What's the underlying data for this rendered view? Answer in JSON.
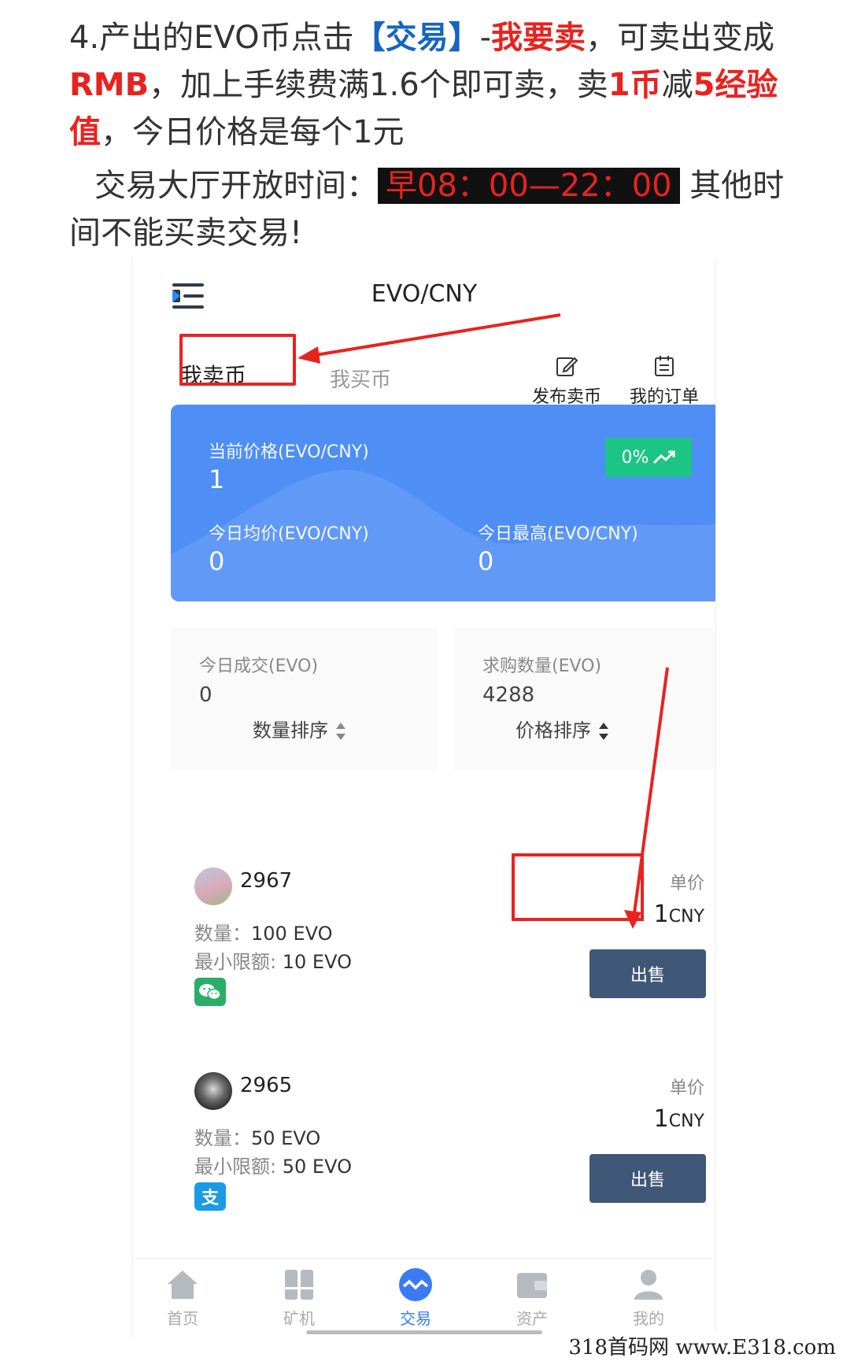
{
  "article": {
    "line1_prefix": "4.产出的EVO币点击",
    "line1_link": "【交易】",
    "line1_dash": "-",
    "line1_emph": "我要卖",
    "line1_rest": "，可卖出变成",
    "rmb": "RMB",
    "line2_rest": "，加上手续费满1.6个即可卖，卖",
    "one_coin": "1币",
    "minus": "减",
    "exp": "5经验值",
    "line3_rest": "，今日价格是每个1元",
    "hours_prefix": "交易大厅开放时间：",
    "hours": "早08：00—22：00",
    "hours_suffix": " 其他时间不能买卖交易!"
  },
  "app": {
    "title": "EVO/CNY",
    "tabs": {
      "sell": "我卖币",
      "buy": "我买币"
    },
    "actions": {
      "publish": "发布卖币",
      "orders": "我的订单"
    },
    "banner": {
      "price_label": "当前价格(EVO/CNY)",
      "price_value": "1",
      "change": "0%",
      "avg_label": "今日均价(EVO/CNY)",
      "avg_value": "0",
      "high_label": "今日最高(EVO/CNY)",
      "high_value": "0"
    },
    "stats": {
      "volume_label": "今日成交(EVO)",
      "volume_value": "0",
      "demand_label": "求购数量(EVO)",
      "demand_value": "4288"
    },
    "sort": {
      "qty": "数量排序",
      "price": "价格排序"
    },
    "orders": [
      {
        "user": "2967",
        "qty_label": "数量：",
        "qty": "100 EVO",
        "min_label": "最小限额:",
        "min": "10 EVO",
        "pay": "wechat-icon",
        "unit_label": "单价",
        "price": "1",
        "currency": "CNY",
        "button": "出售"
      },
      {
        "user": "2965",
        "qty_label": "数量：",
        "qty": "50 EVO",
        "min_label": "最小限额:",
        "min": "50 EVO",
        "pay": "alipay-icon",
        "pay_glyph": "支",
        "unit_label": "单价",
        "price": "1",
        "currency": "CNY",
        "button": "出售"
      }
    ],
    "tabbar": [
      "首页",
      "矿机",
      "交易",
      "资产",
      "我的"
    ]
  },
  "watermark": "318首码网 www.E318.com",
  "colors": {
    "accent_red": "#e8231f",
    "accent_blue": "#1565c0",
    "banner": "#4e8ef5",
    "badge_green": "#1cc586",
    "sell_button": "#3f5878",
    "active_tab": "#3a7bf4"
  }
}
